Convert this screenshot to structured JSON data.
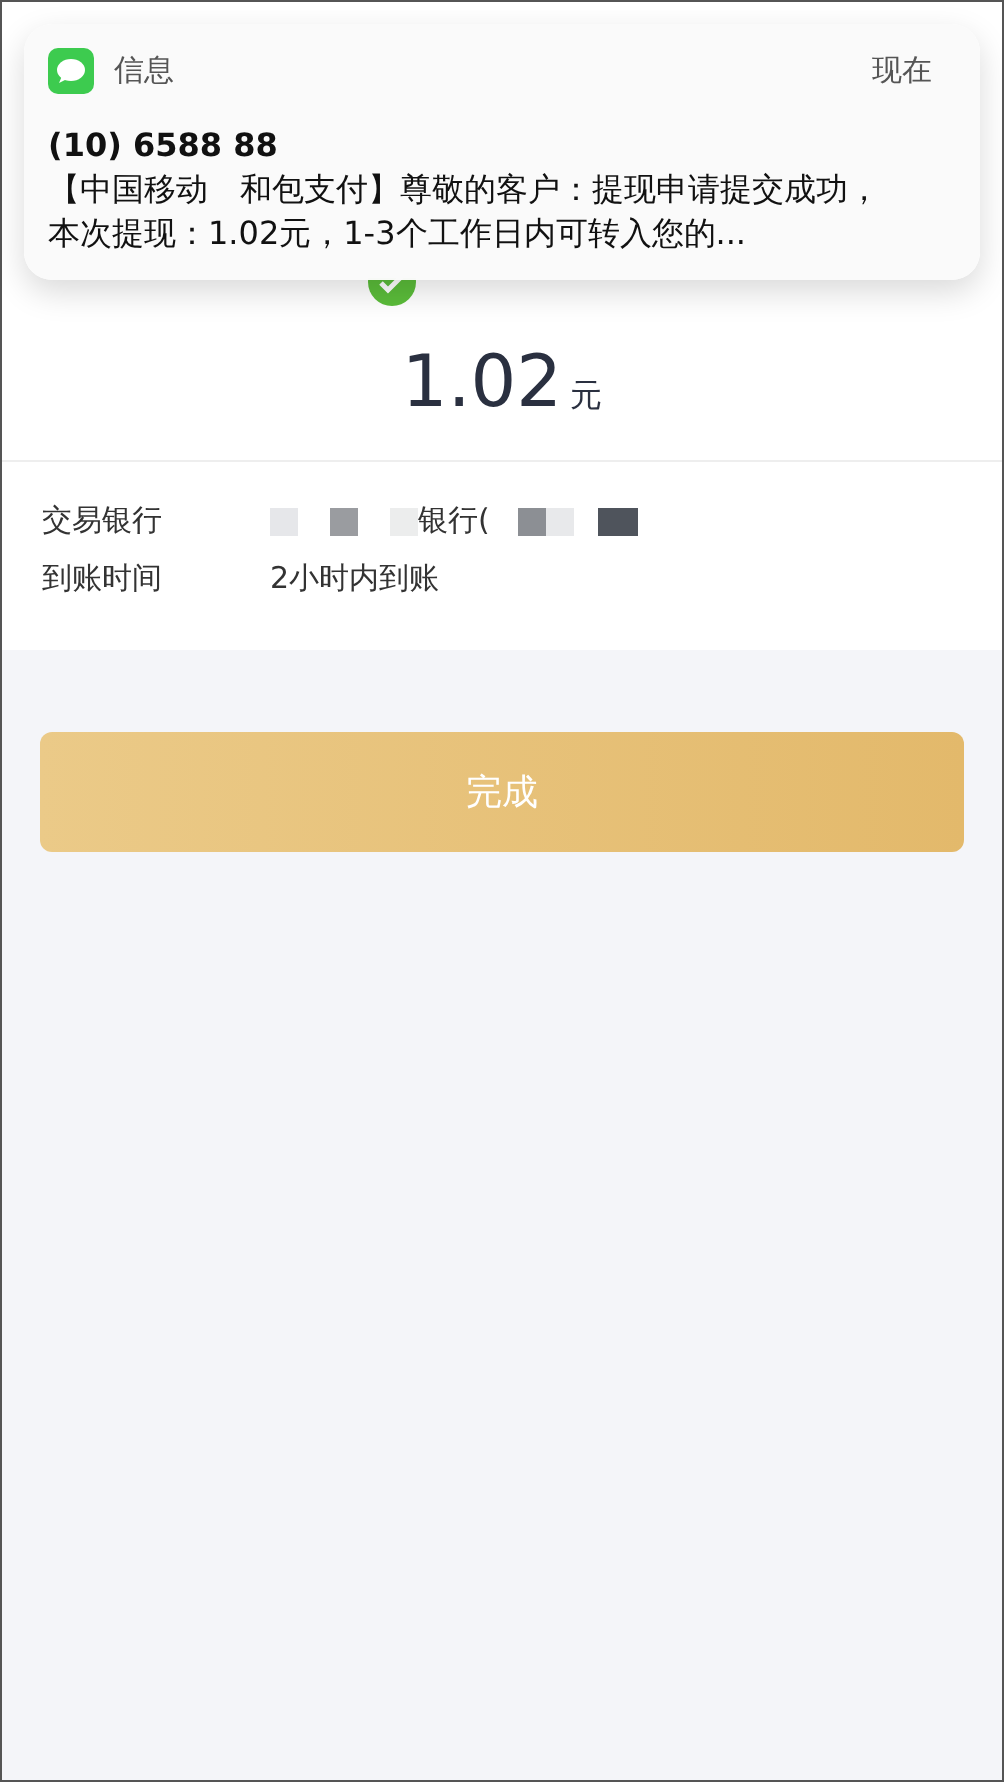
{
  "notification": {
    "app": "信息",
    "time": "现在",
    "sender": "(10) 6588 88",
    "body": "【中国移动　和包支付】尊敬的客户：提现申请提交成功，本次提现：1.02元，1-3个工作日内可转入您的..."
  },
  "result": {
    "amount": "1.02",
    "unit": "元"
  },
  "details": [
    {
      "label": "交易银行",
      "value": "银行(",
      "redacted": true
    },
    {
      "label": "到账时间",
      "value": "2小时内到账",
      "redacted": false
    }
  ],
  "button": "完成"
}
